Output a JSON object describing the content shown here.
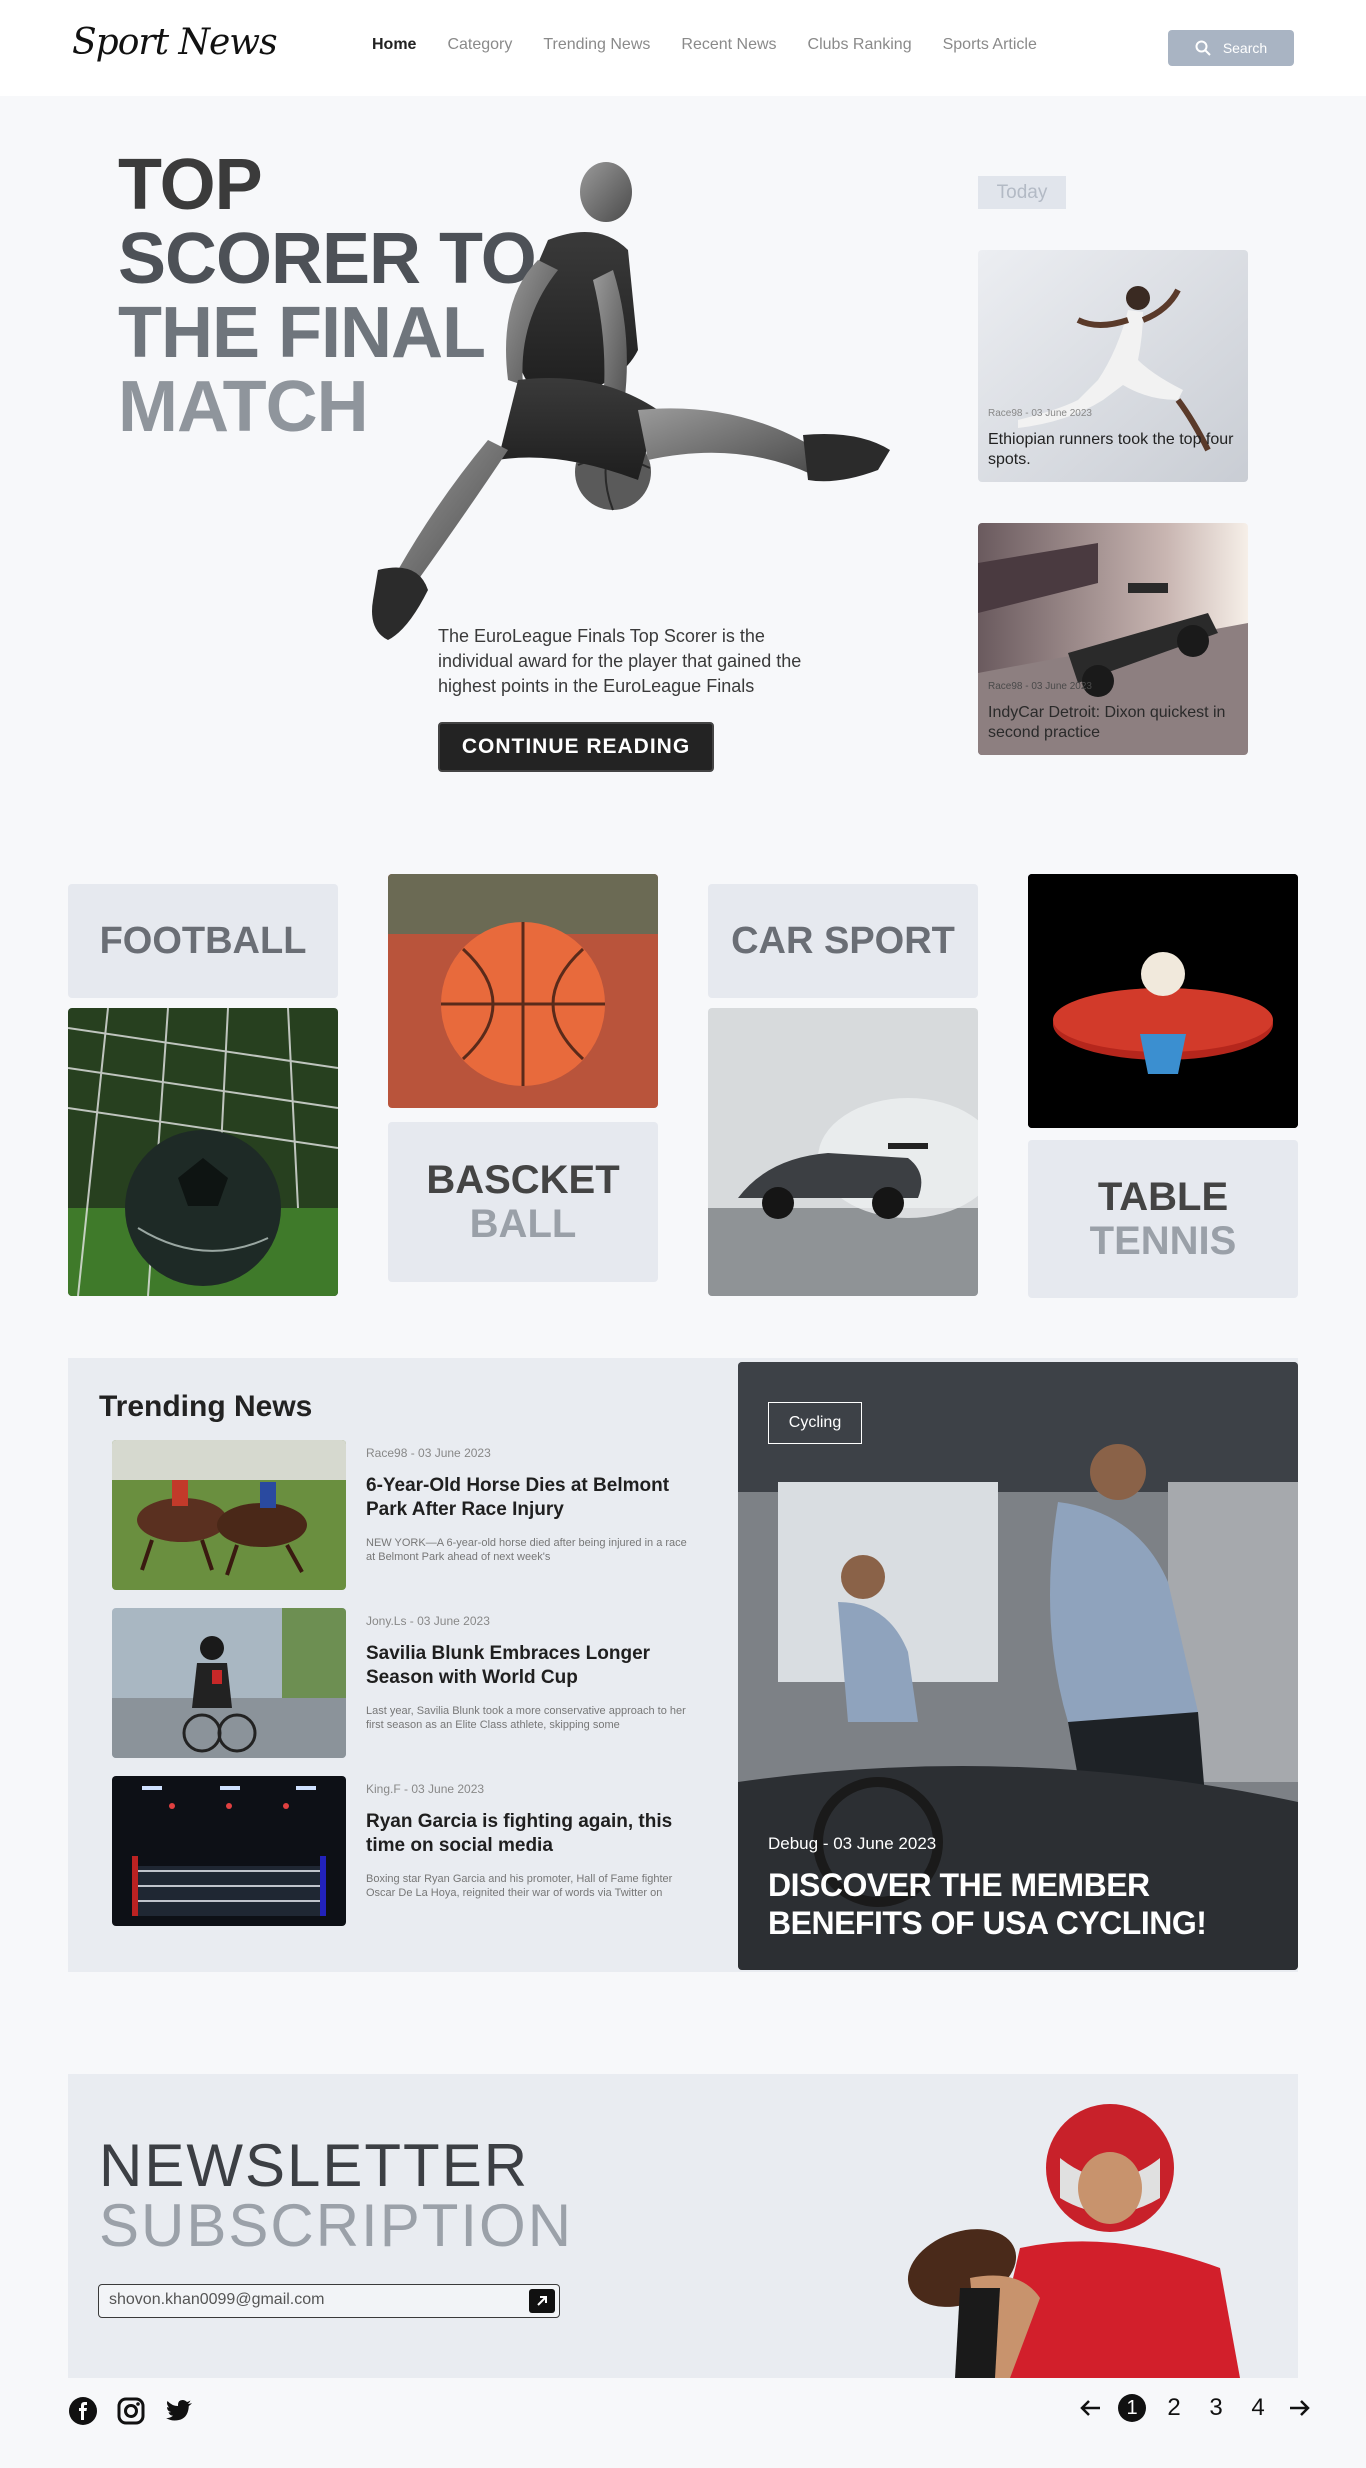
{
  "header": {
    "logo": "Sport News",
    "nav": [
      "Home",
      "Category",
      "Trending News",
      "Recent News",
      "Clubs Ranking",
      "Sports Article"
    ],
    "search_label": "Search"
  },
  "hero": {
    "title_lines": [
      "TOP",
      "SCORER TO",
      "THE FINAL",
      "MATCH"
    ],
    "description": "The EuroLeague Finals Top Scorer is the individual award for the player that gained the highest points in the EuroLeague Finals",
    "cta": "CONTINUE READING"
  },
  "today": {
    "badge": "Today",
    "cards": [
      {
        "meta": "Race98 - 03 June 2023",
        "title": "Ethiopian runners took the top four spots."
      },
      {
        "meta": "Race98 - 03 June 2023",
        "title": "IndyCar Detroit: Dixon quickest in second practice"
      }
    ]
  },
  "categories": {
    "football": "FOOTBALL",
    "basketball": [
      "BASCKET",
      "BALL"
    ],
    "carsport": "CAR SPORT",
    "tabletennis": [
      "TABLE",
      "TENNIS"
    ]
  },
  "trending": {
    "heading": "Trending News",
    "items": [
      {
        "meta": "Race98 - 03 June 2023",
        "title": "6-Year-Old Horse Dies at Belmont Park After Race Injury",
        "excerpt": "NEW YORK—A 6-year-old horse died after being injured in a race at Belmont Park ahead of next week's"
      },
      {
        "meta": "Jony.Ls - 03 June 2023",
        "title": "Savilia Blunk Embraces Longer Season with World Cup",
        "excerpt": "Last year, Savilia Blunk took a more conservative approach to her first season as an Elite Class athlete, skipping some"
      },
      {
        "meta": "King.F - 03 June 2023",
        "title": "Ryan Garcia is fighting again, this time on social media",
        "excerpt": "Boxing star Ryan Garcia and his promoter, Hall of Fame fighter Oscar De La Hoya, reignited their war of words via Twitter on"
      }
    ],
    "feature": {
      "tag": "Cycling",
      "meta": "Debug - 03 June 2023",
      "headline": "DISCOVER THE MEMBER BENEFITS OF USA CYCLING!"
    }
  },
  "newsletter": {
    "title_lines": [
      "NEWSLETTER",
      "SUBSCRIPTION"
    ],
    "email_value": "shovon.khan0099@gmail.com"
  },
  "footer": {
    "pages": [
      "1",
      "2",
      "3",
      "4"
    ],
    "current_page": "1"
  }
}
